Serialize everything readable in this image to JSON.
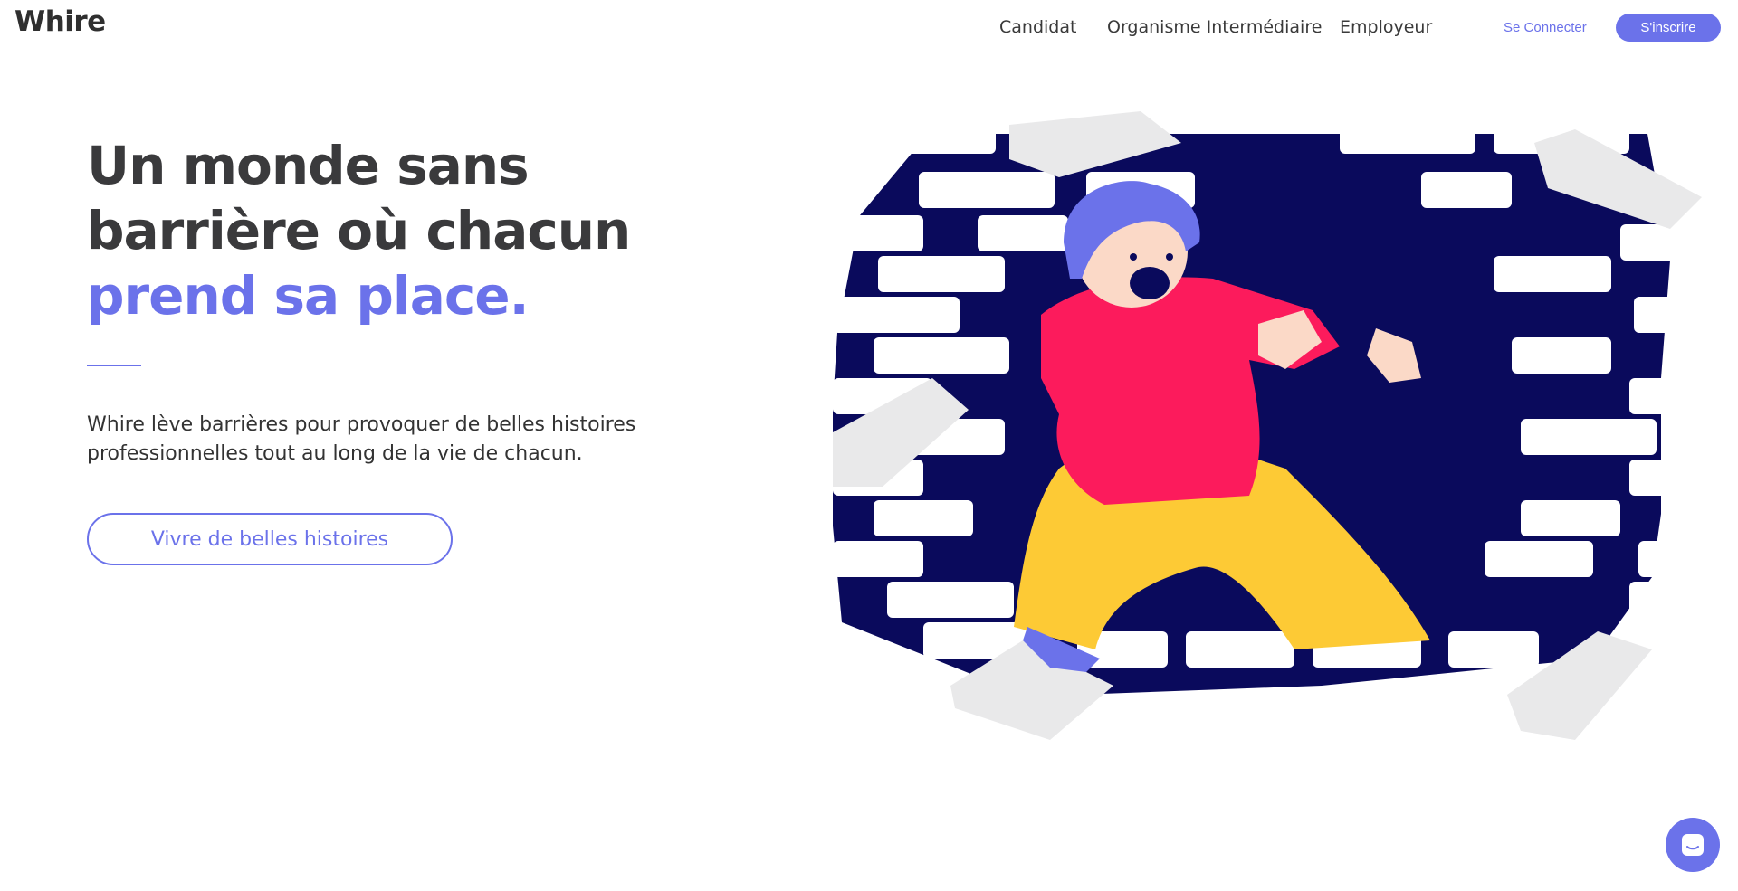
{
  "brand": {
    "name": "Whire",
    "accent_color": "#6b72ea",
    "text_color": "#3a3a3c"
  },
  "nav": {
    "items": [
      {
        "label": "Candidat"
      },
      {
        "label": "Organisme Intermédiaire"
      },
      {
        "label": "Employeur"
      }
    ],
    "login_label": "Se Connecter",
    "signup_label": "S'inscrire"
  },
  "hero": {
    "title_line1": "Un monde sans",
    "title_line2": "barrière où chacun",
    "title_accent": "prend sa place.",
    "subtitle_line1": "Whire lève barrières pour provoquer de belles histoires",
    "subtitle_line2": "professionnelles tout au long de la vie de chacun.",
    "cta_label": "Vivre de belles histoires"
  },
  "illustration": {
    "subject": "character breaking through a brick wall"
  },
  "chat": {
    "icon": "chat-icon"
  }
}
